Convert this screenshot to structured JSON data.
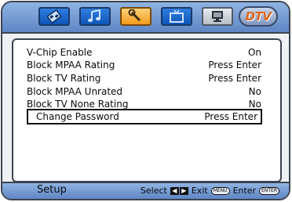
{
  "tabs": [
    {
      "icon": "picture-icon",
      "active": false
    },
    {
      "icon": "music-note-icon",
      "active": false
    },
    {
      "icon": "wrench-icon",
      "active": true
    },
    {
      "icon": "tv-icon",
      "active": false
    },
    {
      "icon": "monitor-icon",
      "active": false
    }
  ],
  "brand": {
    "text": "DTV"
  },
  "menu": {
    "items": [
      {
        "label": "V-Chip Enable",
        "value": "On"
      },
      {
        "label": "Block MPAA Rating",
        "value": "Press Enter"
      },
      {
        "label": "Block TV Rating",
        "value": "Press Enter"
      },
      {
        "label": "Block MPAA Unrated",
        "value": "No"
      },
      {
        "label": "Block TV None Rating",
        "value": "No"
      },
      {
        "label": "Change Password",
        "value": "Press Enter",
        "selected": true
      }
    ]
  },
  "status": {
    "title": "Setup",
    "select_label": "Select",
    "exit_label": "Exit",
    "exit_key": "MENU",
    "enter_label": "Enter",
    "enter_key": "ENTER"
  },
  "colors": {
    "bar": "#7a9fd6",
    "tab": "#1565c8",
    "tab_active": "#f5a623",
    "brand": "#e0671a"
  }
}
